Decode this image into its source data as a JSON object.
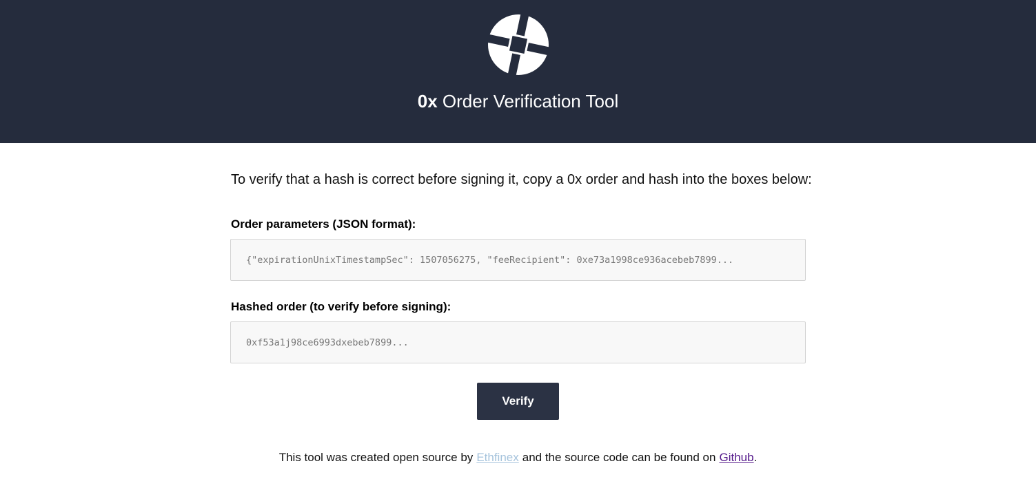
{
  "header": {
    "brand": "0x",
    "title": "Order Verification Tool",
    "background": "#252c3d"
  },
  "intro": "To verify that a hash is correct before signing it, copy a 0x order and hash into the boxes below:",
  "order_field": {
    "label": "Order parameters (JSON format):",
    "placeholder": "{\"expirationUnixTimestampSec\": 1507056275, \"feeRecipient\": 0xe73a1998ce936acebeb7899...",
    "value": ""
  },
  "hash_field": {
    "label": "Hashed order (to verify before signing):",
    "placeholder": "0xf53a1j98ce6993dxebeb7899...",
    "value": ""
  },
  "verify_button": {
    "label": "Verify",
    "color": "#2b3244"
  },
  "footer": {
    "prefix": "This tool was created open source by",
    "ethfinex_link": "Ethfinex",
    "middle": "and the source code can be found on",
    "github_link": "Github",
    "suffix": "."
  },
  "icons": {
    "logo": "0x-logo-icon"
  }
}
